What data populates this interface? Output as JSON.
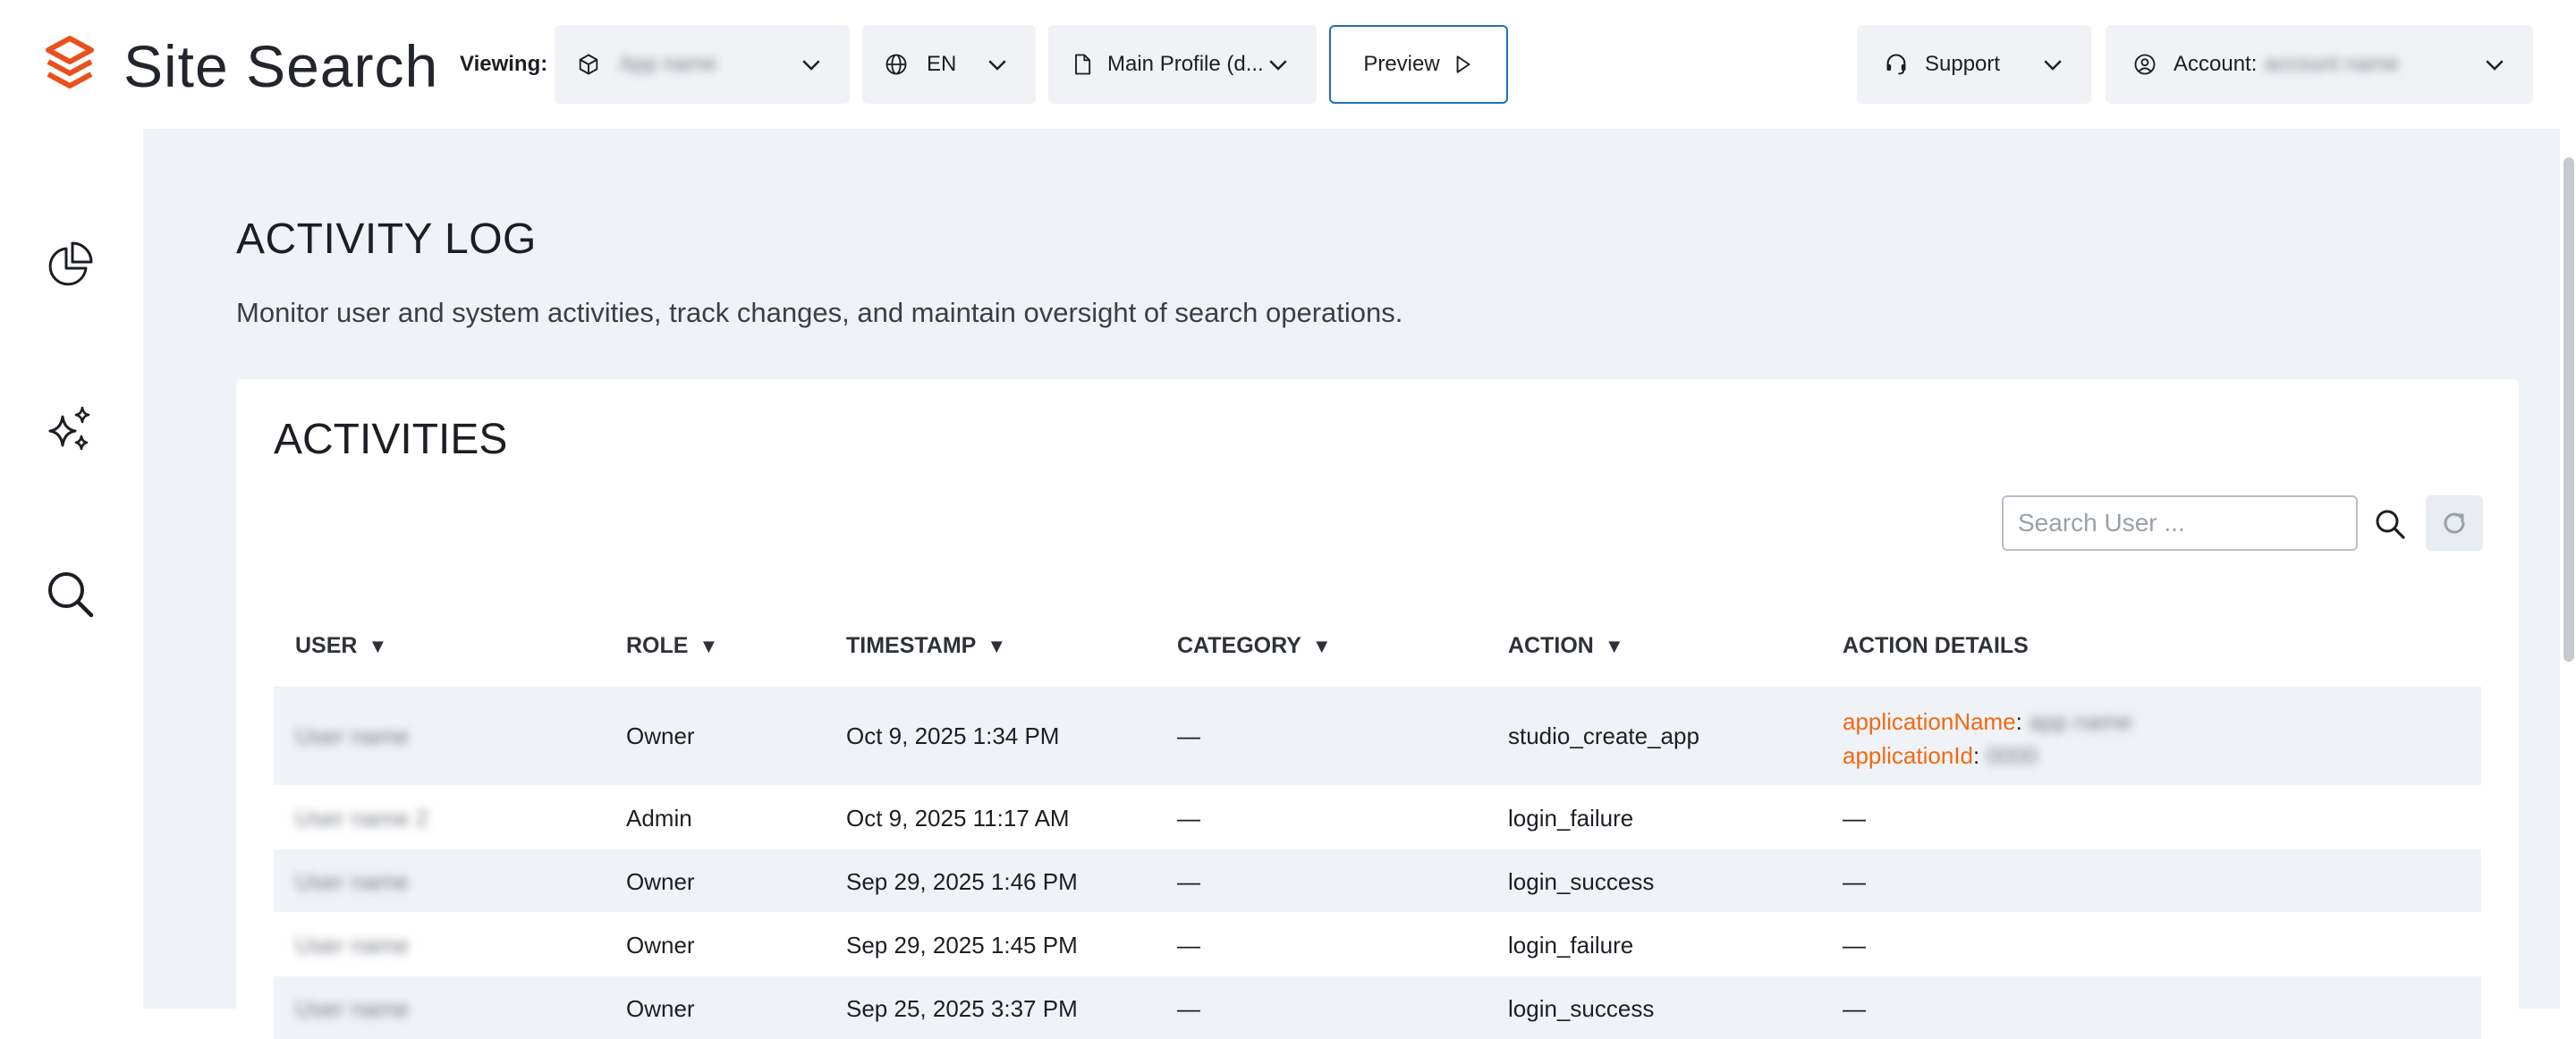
{
  "brand": {
    "name": "Site Search",
    "color": "#e8501c"
  },
  "header": {
    "viewing_label": "Viewing:",
    "app_select": {
      "value": "App name",
      "icon": "cube-icon"
    },
    "language_select": {
      "value": "EN",
      "icon": "globe-icon"
    },
    "profile_select": {
      "value": "Main Profile (d...",
      "icon": "file-icon"
    },
    "preview_label": "Preview",
    "support_label": "Support",
    "account_label": "Account:",
    "account_value": "account name"
  },
  "sidebar": {
    "items": [
      {
        "name": "analytics",
        "icon": "pie-chart-icon"
      },
      {
        "name": "ai",
        "icon": "sparkles-icon"
      },
      {
        "name": "search",
        "icon": "search-icon"
      }
    ]
  },
  "page": {
    "title": "ACTIVITY LOG",
    "description": "Monitor user and system activities, track changes, and maintain oversight of search operations."
  },
  "activities": {
    "title": "ACTIVITIES",
    "search_placeholder": "Search User ...",
    "columns": [
      {
        "label": "USER",
        "sortable": true
      },
      {
        "label": "ROLE",
        "sortable": true
      },
      {
        "label": "TIMESTAMP",
        "sortable": true
      },
      {
        "label": "CATEGORY",
        "sortable": true
      },
      {
        "label": "ACTION",
        "sortable": true
      },
      {
        "label": "ACTION DETAILS",
        "sortable": false
      }
    ],
    "sort_glyph": "▼",
    "rows": [
      {
        "user": "User name",
        "role": "Owner",
        "timestamp": "Oct 9, 2025 1:34 PM",
        "category": "—",
        "action": "studio_create_app",
        "details": [
          {
            "key": "applicationName",
            "sep": ":",
            "value": "app name"
          },
          {
            "key": "applicationId",
            "sep": ":",
            "value": "0000"
          }
        ]
      },
      {
        "user": "User name 2",
        "role": "Admin",
        "timestamp": "Oct 9, 2025 11:17 AM",
        "category": "—",
        "action": "login_failure",
        "details_text": "—"
      },
      {
        "user": "User name",
        "role": "Owner",
        "timestamp": "Sep 29, 2025 1:46 PM",
        "category": "—",
        "action": "login_success",
        "details_text": "—"
      },
      {
        "user": "User name",
        "role": "Owner",
        "timestamp": "Sep 29, 2025 1:45 PM",
        "category": "—",
        "action": "login_failure",
        "details_text": "—"
      },
      {
        "user": "User name",
        "role": "Owner",
        "timestamp": "Sep 25, 2025 3:37 PM",
        "category": "—",
        "action": "login_success",
        "details_text": "—"
      }
    ]
  },
  "colors": {
    "accent": "#e8501c",
    "detail_key": "#f06a12",
    "preview_border": "#1e6fb8",
    "background": "#eff2f6"
  }
}
